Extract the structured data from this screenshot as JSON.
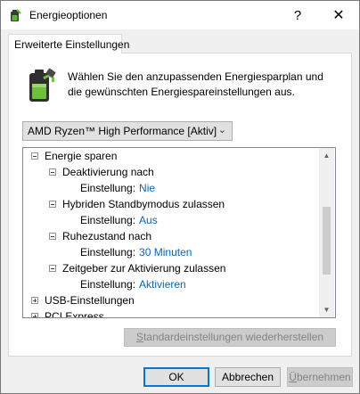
{
  "window": {
    "title": "Energieoptionen",
    "help_label": "?",
    "close_label": "✕"
  },
  "tab": {
    "label": "Erweiterte Einstellungen"
  },
  "intro": {
    "text": "Wählen Sie den anzupassenden Energiesparplan und die gewünschten Energiespareinstellungen aus."
  },
  "plan_select": {
    "value": "AMD Ryzen™ High Performance [Aktiv]"
  },
  "tree": {
    "energy_saving": "Energie sparen",
    "deactivation": "Deaktivierung nach",
    "deactivation_setting_label": "Einstellung:",
    "deactivation_setting_value": "Nie",
    "hybrid_standby": "Hybriden Standbymodus zulassen",
    "hybrid_setting_label": "Einstellung:",
    "hybrid_setting_value": "Aus",
    "hibernate": "Ruhezustand nach",
    "hibernate_setting_label": "Einstellung:",
    "hibernate_setting_value": "30 Minuten",
    "wake_timers": "Zeitgeber zur Aktivierung zulassen",
    "wake_setting_label": "Einstellung:",
    "wake_setting_value": "Aktivieren",
    "usb": "USB-Einstellungen",
    "pci": "PCI Express"
  },
  "buttons": {
    "restore_pre": "S",
    "restore_post": "tandardeinstellungen wiederherstellen",
    "ok": "OK",
    "cancel": "Abbrechen",
    "apply_pre": "Ü",
    "apply_post": "bernehmen"
  },
  "colors": {
    "value_link": "#0066cc",
    "accent": "#0078d7"
  }
}
